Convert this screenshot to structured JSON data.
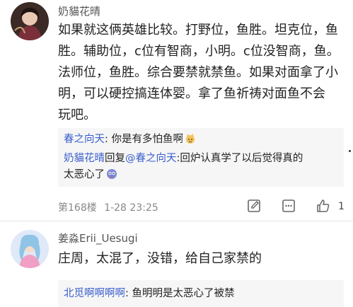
{
  "posts": [
    {
      "username": "奶貓花晴",
      "text_lines": [
        "如果就这俩英雄比较。打野位，鱼胜。坦克位，鱼",
        "胜。辅助位，c位有智商，小明。c位没智商，鱼。",
        "法师位，鱼胜。综合要禁就禁鱼。如果对面拿了小",
        "明，可以硬控搞连体婴。拿了鱼祈祷对面鱼不会",
        "玩吧。"
      ],
      "replies": [
        {
          "user": "春之向天",
          "separator": ":",
          "text": " 你是有多怕鱼啊"
        },
        {
          "user": "奶貓花晴",
          "reply_word": "回复",
          "mention": "@春之向天",
          "separator": ":",
          "text_line1": "回炉认真学了以后觉得真的",
          "text_line2": "太恶心了"
        }
      ],
      "floor": "第168楼",
      "timestamp": "1-28 23:25",
      "like_count": "1"
    },
    {
      "username": "姜淼Erii_Uesugi",
      "text_lines": [
        "庄周，太混了，没错，给自己家禁的"
      ],
      "replies": [
        {
          "user": "北觅啊啊啊啊",
          "separator": ":",
          "text": " 鱼明明是太恶心了被禁"
        }
      ]
    }
  ],
  "icons": {
    "reply": "edit-icon",
    "more": "more-icon",
    "like": "thumbs-up-icon"
  },
  "colors": {
    "link_blue": "#3a5fcd",
    "reply_bg": "#f6f6f6",
    "meta_gray": "#888888"
  }
}
